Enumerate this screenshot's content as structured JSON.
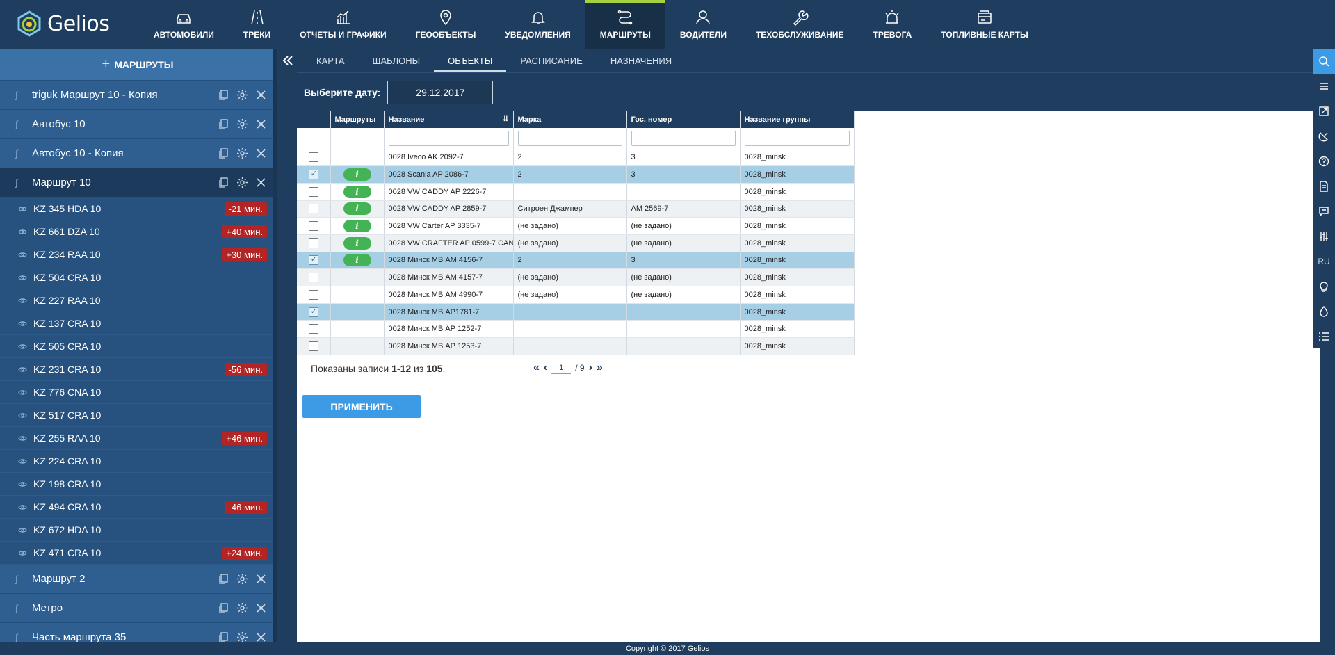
{
  "app": {
    "logo_text": "Gelios"
  },
  "nav": [
    {
      "label": "АВТОМОБИЛИ",
      "icon": "car-icon",
      "active": false
    },
    {
      "label": "ТРЕКИ",
      "icon": "track-icon",
      "active": false
    },
    {
      "label": "ОТЧЕТЫ И ГРАФИКИ",
      "icon": "chart-icon",
      "active": false
    },
    {
      "label": "ГЕООБЪЕКТЫ",
      "icon": "map-pin-icon",
      "active": false
    },
    {
      "label": "УВЕДОМЛЕНИЯ",
      "icon": "bell-icon",
      "active": false
    },
    {
      "label": "МАРШРУТЫ",
      "icon": "route-icon",
      "active": true
    },
    {
      "label": "ВОДИТЕЛИ",
      "icon": "user-icon",
      "active": false
    },
    {
      "label": "ТЕХОБСЛУЖИВАНИЕ",
      "icon": "wrench-icon",
      "active": false
    },
    {
      "label": "ТРЕВОГА",
      "icon": "alarm-icon",
      "active": false
    },
    {
      "label": "ТОПЛИВНЫЕ КАРТЫ",
      "icon": "fuel-card-icon",
      "active": false
    }
  ],
  "sidebar": {
    "header": "МАРШРУТЫ",
    "routes_top": [
      {
        "name": "triguk Маршрут 10 - Копия"
      },
      {
        "name": "Автобус 10"
      },
      {
        "name": "Автобус 10 - Копия"
      }
    ],
    "active_route": {
      "name": "Маршрут 10"
    },
    "vehicles": [
      {
        "name": "KZ 345 HDA 10",
        "delay": "-21 мин."
      },
      {
        "name": "KZ 661 DZA 10",
        "delay": "+40 мин."
      },
      {
        "name": "KZ 234 RAA 10",
        "delay": "+30 мин."
      },
      {
        "name": "KZ 504 CRA 10",
        "delay": ""
      },
      {
        "name": "KZ 227 RAA 10",
        "delay": ""
      },
      {
        "name": "KZ 137 CRA 10",
        "delay": ""
      },
      {
        "name": "KZ 505 CRA 10",
        "delay": ""
      },
      {
        "name": "KZ 231 CRA 10",
        "delay": "-56 мин."
      },
      {
        "name": "KZ 776 CNA 10",
        "delay": ""
      },
      {
        "name": "KZ 517 CRA 10",
        "delay": ""
      },
      {
        "name": "KZ 255 RAA 10",
        "delay": "+46 мин."
      },
      {
        "name": "KZ 224 CRA 10",
        "delay": ""
      },
      {
        "name": "KZ 198 CRA 10",
        "delay": ""
      },
      {
        "name": "KZ 494 CRA 10",
        "delay": "-46 мин."
      },
      {
        "name": "KZ 672 HDA 10",
        "delay": ""
      },
      {
        "name": "KZ 471 CRA 10",
        "delay": "+24 мин."
      }
    ],
    "routes_bottom": [
      {
        "name": "Маршрут 2"
      },
      {
        "name": "Метро"
      },
      {
        "name": "Часть маршрута 35"
      }
    ]
  },
  "tabs": [
    {
      "label": "КАРТА",
      "active": false
    },
    {
      "label": "ШАБЛОНЫ",
      "active": false
    },
    {
      "label": "ОБЪЕКТЫ",
      "active": true
    },
    {
      "label": "РАСПИСАНИЕ",
      "active": false
    },
    {
      "label": "НАЗНАЧЕНИЯ",
      "active": false
    }
  ],
  "date": {
    "label": "Выберите дату:",
    "value": "29.12.2017"
  },
  "table": {
    "columns": [
      "Маршруты",
      "Название",
      "Марка",
      "Гос. номер",
      "Название группы"
    ],
    "rows": [
      {
        "checked": false,
        "info": false,
        "name": "0028 Iveco AK 2092-7",
        "brand": "2",
        "plate": "3",
        "group": "0028_minsk"
      },
      {
        "checked": true,
        "info": true,
        "name": "0028 Scania AP 2086-7",
        "brand": "2",
        "plate": "3",
        "group": "0028_minsk"
      },
      {
        "checked": false,
        "info": true,
        "name": "0028 VW CADDY AP 2226-7",
        "brand": "",
        "plate": "",
        "group": "0028_minsk"
      },
      {
        "checked": false,
        "info": true,
        "name": "0028 VW CADDY AP 2859-7",
        "brand": "Ситроен Джампер",
        "plate": "АМ 2569-7",
        "group": "0028_minsk"
      },
      {
        "checked": false,
        "info": true,
        "name": "0028 VW Carter AP 3335-7",
        "brand": "(не задано)",
        "plate": "(не задано)",
        "group": "0028_minsk"
      },
      {
        "checked": false,
        "info": true,
        "name": "0028 VW CRAFTER AP 0599-7 CAN",
        "brand": "(не задано)",
        "plate": "(не задано)",
        "group": "0028_minsk"
      },
      {
        "checked": true,
        "info": true,
        "name": "0028 Минск МВ АМ 4156-7",
        "brand": "2",
        "plate": "3",
        "group": "0028_minsk"
      },
      {
        "checked": false,
        "info": false,
        "name": "0028 Минск МВ АМ 4157-7",
        "brand": "(не задано)",
        "plate": "(не задано)",
        "group": "0028_minsk"
      },
      {
        "checked": false,
        "info": false,
        "name": "0028 Минск МВ АМ 4990-7",
        "brand": "(не задано)",
        "plate": "(не задано)",
        "group": "0028_minsk"
      },
      {
        "checked": true,
        "info": false,
        "name": "0028 Минск МВ АР1781-7",
        "brand": "",
        "plate": "",
        "group": "0028_minsk"
      },
      {
        "checked": false,
        "info": false,
        "name": "0028 Минск МВ АР 1252-7",
        "brand": "",
        "plate": "",
        "group": "0028_minsk"
      },
      {
        "checked": false,
        "info": false,
        "name": "0028 Минск МВ АР 1253-7",
        "brand": "",
        "plate": "",
        "group": "0028_minsk"
      }
    ],
    "info_label": "i"
  },
  "pager": {
    "prefix": "Показаны записи ",
    "range": "1-12",
    "of": " из ",
    "total": "105",
    "suffix": ".",
    "page": "1",
    "pages": "/ 9"
  },
  "apply_button": "ПРИМЕНИТЬ",
  "right_toolbar": [
    {
      "icon": "search-icon",
      "active": true
    },
    {
      "icon": "menu-icon"
    },
    {
      "icon": "external-link-icon"
    },
    {
      "icon": "satellite-icon"
    },
    {
      "icon": "help-icon"
    },
    {
      "icon": "document-icon"
    },
    {
      "icon": "chat-icon"
    },
    {
      "icon": "sliders-icon"
    },
    {
      "icon": "language-icon",
      "label": "RU"
    },
    {
      "icon": "bulb-icon"
    },
    {
      "icon": "drop-icon"
    },
    {
      "icon": "list-icon"
    }
  ],
  "footer": "Copyright © 2017 Gelios",
  "colors": {
    "primary": "#1f3d5e",
    "sidebar": "#2a5787",
    "accent": "#a6d140",
    "button": "#3d9be6",
    "delay_badge": "#b32424",
    "info_pill": "#44b356",
    "selected_row": "#a6cfe6"
  }
}
